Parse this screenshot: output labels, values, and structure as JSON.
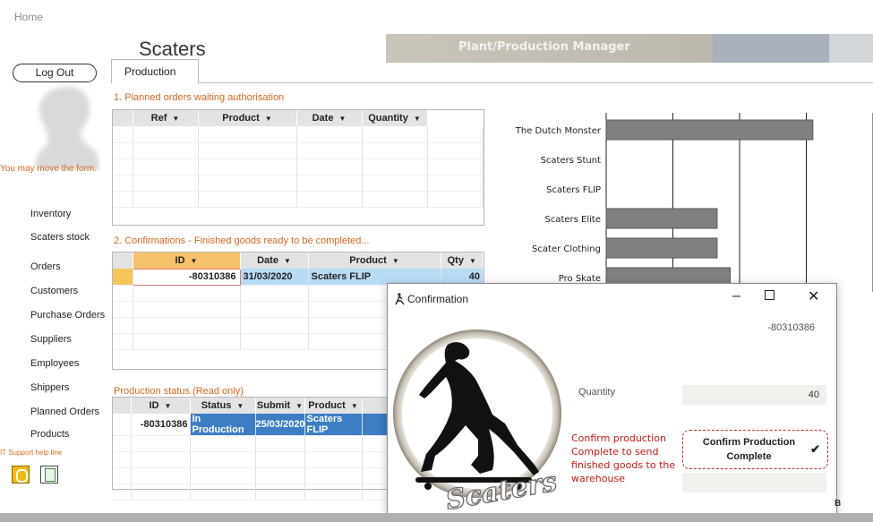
{
  "breadcrumb": "Home",
  "app_title": "Scaters",
  "banner_title": "Plant/Production Manager",
  "tab_label": "Production",
  "sidebar": {
    "logout": "Log Out",
    "move_hint": "You may move the form.",
    "items": [
      {
        "label": "Inventory"
      },
      {
        "label": "Scaters stock"
      },
      {
        "label": "Orders"
      },
      {
        "label": "Customers"
      },
      {
        "label": "Purchase Orders"
      },
      {
        "label": "Suppliers"
      },
      {
        "label": "Employees"
      },
      {
        "label": "Shippers"
      },
      {
        "label": "Planned Orders"
      },
      {
        "label": "Products"
      }
    ],
    "it_support": "IT Support help line"
  },
  "planned": {
    "title": "1. Planned orders waiting authorisation",
    "columns": [
      "Ref",
      "Product",
      "Date",
      "Quantity"
    ]
  },
  "confirmations": {
    "title": "2. Confirmations - Finished goods ready to be completed...",
    "columns": [
      "ID",
      "Date",
      "Product",
      "Qty"
    ],
    "row": {
      "id": "-80310386",
      "date": "31/03/2020",
      "product": "Scaters FLIP",
      "qty": "40"
    }
  },
  "status": {
    "title": "Production status (Read only)",
    "columns": [
      "ID",
      "Status",
      "Submit",
      "Product"
    ],
    "row": {
      "id": "-80310386",
      "status": "In Production",
      "submit": "25/03/2020",
      "product": "Scaters FLIP"
    }
  },
  "chart_data": {
    "type": "bar",
    "categories": [
      "The Dutch Monster",
      "Scaters Stunt",
      "Scaters FLIP",
      "Scaters Elite",
      "Scater Clothing",
      "Pro Skate"
    ],
    "values": [
      95,
      0,
      0,
      51,
      51,
      57
    ],
    "xlim": [
      0,
      100
    ]
  },
  "dialog": {
    "title": "Confirmation",
    "order_id": "-80310386",
    "quantity_label": "Quantity",
    "quantity_value": "40",
    "instructions": "Confirm production Complete to send finished goods to the warehouse",
    "confirm_button": "Confirm Production Complete",
    "logo_text": "Scaters"
  },
  "stray_char": "B"
}
